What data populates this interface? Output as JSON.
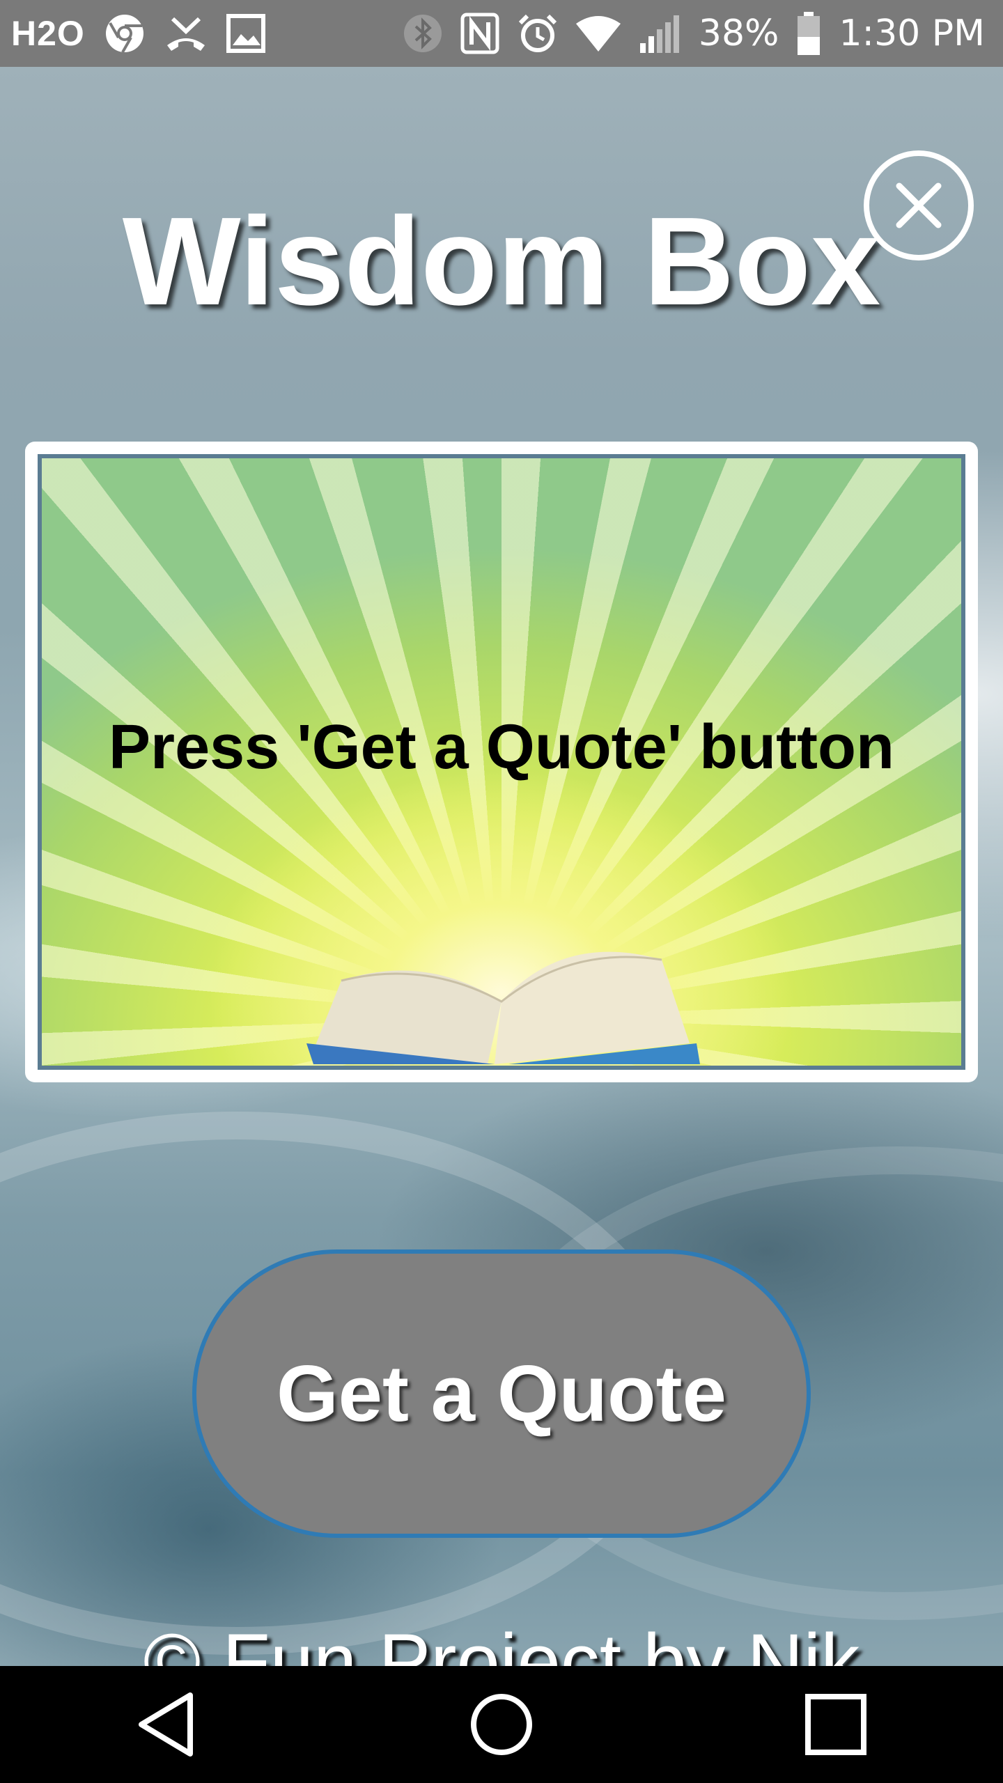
{
  "status_bar": {
    "carrier": "H2O",
    "battery": "38%",
    "time": "1:30 PM",
    "left_icons": [
      "chrome-icon",
      "missed-call-icon",
      "image-icon"
    ],
    "right_icons": [
      "bluetooth-icon",
      "nfc-icon",
      "alarm-icon",
      "wifi-icon",
      "signal-icon",
      "battery-icon"
    ]
  },
  "app": {
    "title": "Wisdom Box",
    "quote_text": "Press 'Get a Quote' button",
    "button_label": "Get a Quote",
    "footer": "© Fun Project by Nik",
    "colors": {
      "button_fill": "#808080",
      "button_border": "#2f7bb5",
      "frame_border": "#ffffff"
    }
  },
  "nav_bar": {
    "buttons": [
      "back-icon",
      "home-icon",
      "recents-icon"
    ]
  }
}
